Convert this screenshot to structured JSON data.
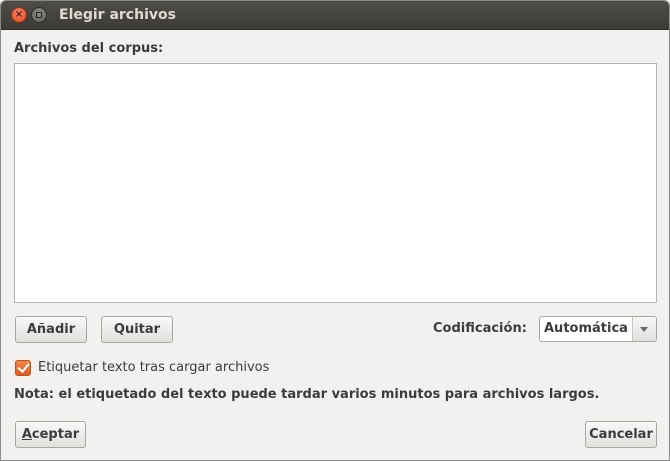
{
  "window": {
    "title": "Elegir archivos",
    "close_glyph": "×"
  },
  "corpus": {
    "label": "Archivos del corpus:",
    "files": []
  },
  "buttons": {
    "add_label": "Añadir",
    "remove_label": "Quitar",
    "accept_label": "Aceptar",
    "accept_mnemonic": "A",
    "accept_rest": "ceptar",
    "cancel_label": "Cancelar"
  },
  "encoding": {
    "label": "Codificación:",
    "selected": "Automática"
  },
  "tag_option": {
    "label": "Etiquetar texto tras cargar archivos",
    "checked": true
  },
  "note": "Nota: el etiquetado del texto puede tardar varios minutos para archivos largos.",
  "colors": {
    "accent": "#dd5a1c",
    "titlebar": "#3c3b37",
    "window_bg": "#f2f1f0"
  },
  "icons": {
    "close": "close-icon",
    "maximize": "maximize-icon",
    "combo_arrow": "chevron-down-icon",
    "check": "checkmark-icon"
  }
}
